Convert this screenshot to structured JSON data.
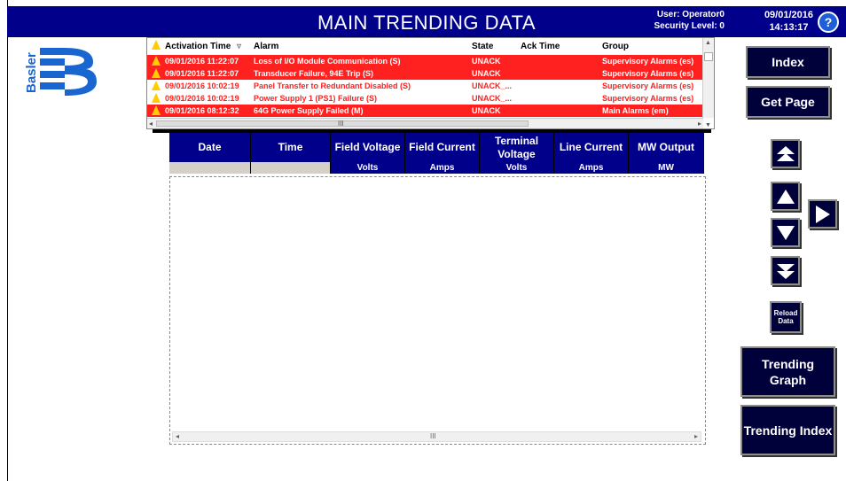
{
  "header": {
    "title": "MAIN TRENDING DATA",
    "user": "User: Operator0",
    "security": "Security Level: 0",
    "date": "09/01/2016",
    "time": "14:13:17",
    "help_icon": "?"
  },
  "logo": {
    "text": "Basler"
  },
  "alarms": {
    "columns": {
      "activation": "Activation Time",
      "alarm": "Alarm",
      "state": "State",
      "ack": "Ack Time",
      "group": "Group"
    },
    "rows": [
      {
        "time": "09/01/2016 11:22:07",
        "alarm": "Loss of I/O Module Communication (S)",
        "state": "UNACK",
        "group": "Supervisory Alarms (es)",
        "style": "red"
      },
      {
        "time": "09/01/2016 11:22:07",
        "alarm": "Transducer Failure, 94E Trip (S)",
        "state": "UNACK",
        "group": "Supervisory Alarms (es)",
        "style": "red"
      },
      {
        "time": "09/01/2016 10:02:19",
        "alarm": "Panel Transfer to Redundant Disabled (S)",
        "state": "UNACK_...",
        "group": "Supervisory Alarms (es)",
        "style": "white"
      },
      {
        "time": "09/01/2016 10:02:19",
        "alarm": "Power Supply 1 (PS1) Failure (S)",
        "state": "UNACK_...",
        "group": "Supervisory Alarms (es)",
        "style": "white"
      },
      {
        "time": "09/01/2016 08:12:32",
        "alarm": "64G Power Supply Failed (M)",
        "state": "UNACK",
        "group": "Main Alarms (em)",
        "style": "red"
      }
    ],
    "scroll_mark": "III"
  },
  "table": {
    "headers": [
      "Date",
      "Time",
      "Field Voltage",
      "Field Current",
      "Terminal Voltage",
      "Line Current",
      "MW Output"
    ],
    "units": [
      "",
      "",
      "Volts",
      "Amps",
      "Volts",
      "Amps",
      "MW"
    ],
    "scroll_mark": "III"
  },
  "buttons": {
    "index": "Index",
    "get_page": "Get Page",
    "reload": "Reload Data",
    "trending_graph": "Trending Graph",
    "trending_index": "Trending Index"
  },
  "colors": {
    "navy": "#00008b",
    "alarm_red": "#ff2020",
    "button_dark": "#00003a"
  }
}
